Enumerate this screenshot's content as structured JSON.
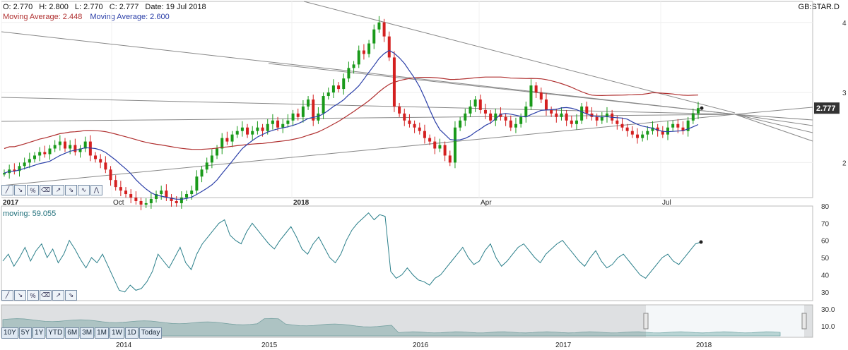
{
  "header": {
    "open": "O: 2.770",
    "high": "H: 2.800",
    "low": "L: 2.770",
    "close": "C: 2.777",
    "date": "Date: 19 Jul 2018",
    "ticker": "GB:STAR.D",
    "ma_red": "Moving Average: 2.448",
    "ma_blue": "Moving Average: 2.600"
  },
  "colors": {
    "up": "#1a9a1a",
    "down": "#d42020",
    "ma_red": "#b03030",
    "ma_blue": "#2b3fa8",
    "oscillator": "#2a7f8a",
    "trend": "#888888",
    "nav_fill": "#b9d4d4"
  },
  "price_chart": {
    "x_labels": [
      "2017",
      "Oct",
      "2018",
      "Apr",
      "Jul"
    ],
    "y_ticks": [
      "2",
      "3",
      "4"
    ],
    "last_value": "2.777"
  },
  "oscillator": {
    "label": "moving: 59.055",
    "y_ticks": [
      "30",
      "40",
      "50",
      "60",
      "70",
      "80"
    ]
  },
  "navigator": {
    "x_labels": [
      "2014",
      "2015",
      "2016",
      "2017",
      "2018"
    ],
    "y_ticks": [
      "10.0",
      "30.0"
    ],
    "range_buttons": [
      "10Y",
      "5Y",
      "1Y",
      "YTD",
      "6M",
      "3M",
      "1M",
      "1W",
      "1D",
      "Today"
    ]
  },
  "tools": {
    "price": [
      "line-tool-icon",
      "arrow-down-icon",
      "percent-icon",
      "eraser-icon",
      "trend-up-icon",
      "trend-down-icon",
      "wave-icon",
      "fib-icon"
    ],
    "osc": [
      "line-tool-icon",
      "arrow-down-icon",
      "percent-icon",
      "eraser-icon",
      "trend-up-icon",
      "trend-down-icon"
    ]
  },
  "chart_data": [
    {
      "type": "candlestick",
      "x_labels": [
        "2017",
        "Oct",
        "2018",
        "Apr",
        "Jul"
      ],
      "ylim": [
        1.5,
        4.3
      ],
      "y_ticks": [
        2,
        3,
        4
      ],
      "last_close": 2.777,
      "close_series": [
        1.85,
        1.9,
        1.88,
        1.95,
        2.0,
        2.05,
        2.1,
        2.15,
        2.12,
        2.2,
        2.25,
        2.3,
        2.2,
        2.25,
        2.15,
        2.2,
        2.3,
        2.1,
        2.05,
        2.0,
        1.9,
        1.75,
        1.65,
        1.6,
        1.55,
        1.5,
        1.45,
        1.4,
        1.42,
        1.48,
        1.55,
        1.6,
        1.5,
        1.45,
        1.42,
        1.5,
        1.55,
        1.6,
        1.8,
        1.9,
        2.0,
        2.1,
        2.2,
        2.35,
        2.3,
        2.4,
        2.45,
        2.5,
        2.4,
        2.45,
        2.5,
        2.45,
        2.55,
        2.6,
        2.5,
        2.55,
        2.6,
        2.7,
        2.65,
        2.8,
        2.9,
        2.6,
        2.7,
        2.95,
        3.0,
        3.1,
        3.05,
        3.2,
        3.35,
        3.4,
        3.6,
        3.55,
        3.7,
        3.9,
        4.0,
        3.8,
        3.5,
        2.8,
        2.7,
        2.6,
        2.55,
        2.5,
        2.45,
        2.35,
        2.3,
        2.2,
        2.25,
        2.1,
        2.0,
        2.5,
        2.6,
        2.7,
        2.8,
        2.9,
        2.75,
        2.7,
        2.6,
        2.7,
        2.65,
        2.6,
        2.5,
        2.55,
        2.65,
        2.8,
        3.1,
        3.0,
        2.9,
        2.75,
        2.7,
        2.65,
        2.7,
        2.6,
        2.55,
        2.6,
        2.8,
        2.7,
        2.65,
        2.6,
        2.65,
        2.7,
        2.6,
        2.55,
        2.5,
        2.45,
        2.4,
        2.35,
        2.4,
        2.45,
        2.5,
        2.45,
        2.4,
        2.5,
        2.55,
        2.5,
        2.45,
        2.6,
        2.7,
        2.777
      ],
      "moving_averages": [
        {
          "name": "Moving Average",
          "value": 2.448
        },
        {
          "name": "Moving Average",
          "value": 2.6
        }
      ]
    },
    {
      "type": "line",
      "ylim": [
        25,
        80
      ],
      "y_ticks": [
        30,
        40,
        50,
        60,
        70,
        80
      ],
      "values": [
        48,
        52,
        45,
        50,
        56,
        48,
        54,
        58,
        50,
        55,
        47,
        52,
        60,
        55,
        49,
        44,
        50,
        47,
        52,
        45,
        38,
        31,
        30,
        34,
        31,
        32,
        36,
        42,
        52,
        48,
        44,
        50,
        56,
        47,
        43,
        52,
        58,
        62,
        66,
        70,
        72,
        63,
        60,
        58,
        65,
        70,
        66,
        62,
        58,
        55,
        60,
        64,
        68,
        62,
        55,
        52,
        58,
        62,
        56,
        50,
        47,
        52,
        60,
        66,
        70,
        73,
        76,
        72,
        75,
        74,
        42,
        38,
        40,
        44,
        40,
        37,
        36,
        34,
        38,
        40,
        44,
        48,
        52,
        56,
        50,
        46,
        48,
        54,
        58,
        50,
        45,
        48,
        52,
        56,
        58,
        54,
        50,
        47,
        52,
        55,
        58,
        60,
        56,
        52,
        48,
        45,
        50,
        54,
        48,
        44,
        46,
        50,
        52,
        48,
        44,
        40,
        38,
        42,
        46,
        50,
        52,
        48,
        46,
        50,
        54,
        58,
        59.055
      ],
      "last_value": 59.055
    },
    {
      "type": "area",
      "x_labels": [
        "2014",
        "2015",
        "2016",
        "2017",
        "2018"
      ],
      "y_ticks": [
        10.0,
        30.0
      ]
    }
  ]
}
